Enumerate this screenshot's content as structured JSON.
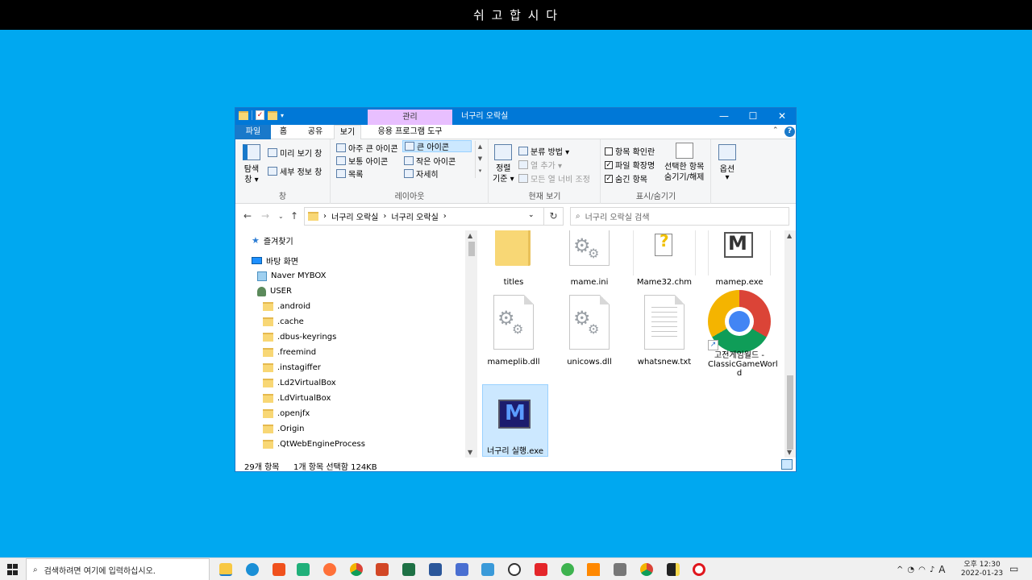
{
  "banner": {
    "text": "쉬 고 합 시 다"
  },
  "window": {
    "title": "너구리 오락실",
    "manage_tab": "관리",
    "controls": {
      "minimize": "—",
      "maximize": "☐",
      "close": "✕"
    }
  },
  "ribbon_tabs": {
    "file": "파일",
    "home": "홈",
    "share": "공유",
    "view": "보기",
    "app_tools": "응용 프로그램 도구"
  },
  "ribbon": {
    "panes": {
      "nav_pane_label_1": "탐색",
      "nav_pane_label_2": "창 ▾",
      "preview": "미리 보기 창",
      "details": "세부 정보 창",
      "group": "창"
    },
    "layout": {
      "extra_large": "아주 큰 아이콘",
      "large": "큰 아이콘",
      "medium": "보통 아이콘",
      "small": "작은 아이콘",
      "list": "목록",
      "details": "자세히",
      "group": "레이아웃"
    },
    "current_view": {
      "sort_1": "정렬",
      "sort_2": "기준 ▾",
      "group_by": "분류 방법 ▾",
      "add_columns": "열 추가 ▾",
      "size_all": "모든 열 너비 조정",
      "group": "현재 보기"
    },
    "show_hide": {
      "item_check": "항목 확인란",
      "file_ext": "파일 확장명",
      "hidden": "숨긴 항목",
      "hide_sel_1": "선택한 항목",
      "hide_sel_2": "숨기기/해제",
      "group": "표시/숨기기"
    },
    "options": {
      "label": "옵션",
      "arrow": "▾"
    }
  },
  "address": {
    "crumbs": [
      "너구리 오락실",
      "너구리 오락실"
    ],
    "sep": "›",
    "search_placeholder": "너구리 오락실 검색"
  },
  "nav_pane": {
    "favorites": "즐겨찾기",
    "desktop": "바탕 화면",
    "mybox": "Naver MYBOX",
    "user": "USER",
    "folders": [
      ".android",
      ".cache",
      ".dbus-keyrings",
      ".freemind",
      ".instagiffer",
      ".Ld2VirtualBox",
      ".LdVirtualBox",
      ".openjfx",
      ".Origin",
      ".QtWebEngineProcess"
    ]
  },
  "files": {
    "titles": "titles",
    "mame_ini": "mame.ini",
    "mame32_chm": "Mame32.chm",
    "mamep_exe": "mamep.exe",
    "mameplib_dll": "mameplib.dll",
    "unicows_dll": "unicows.dll",
    "whatsnew_txt": "whatsnew.txt",
    "classic_1": "고전게임월드 -",
    "classic_2": "ClassicGameWorl",
    "classic_3": "d",
    "neoguri_exe": "너구리 실행.exe"
  },
  "status": {
    "count": "29개 항목",
    "selected": "1개 항목 선택함 124KB"
  },
  "taskbar": {
    "search_placeholder": "검색하려면 여기에 입력하십시오.",
    "clock_period_time": "오후 12:30",
    "clock_date": "2022-01-23",
    "ime": "A"
  },
  "colors": {
    "desktop": "#00a8f0",
    "titlebar": "#0078d7",
    "manage_tab": "#e8bfff",
    "selection": "#cce8ff"
  }
}
